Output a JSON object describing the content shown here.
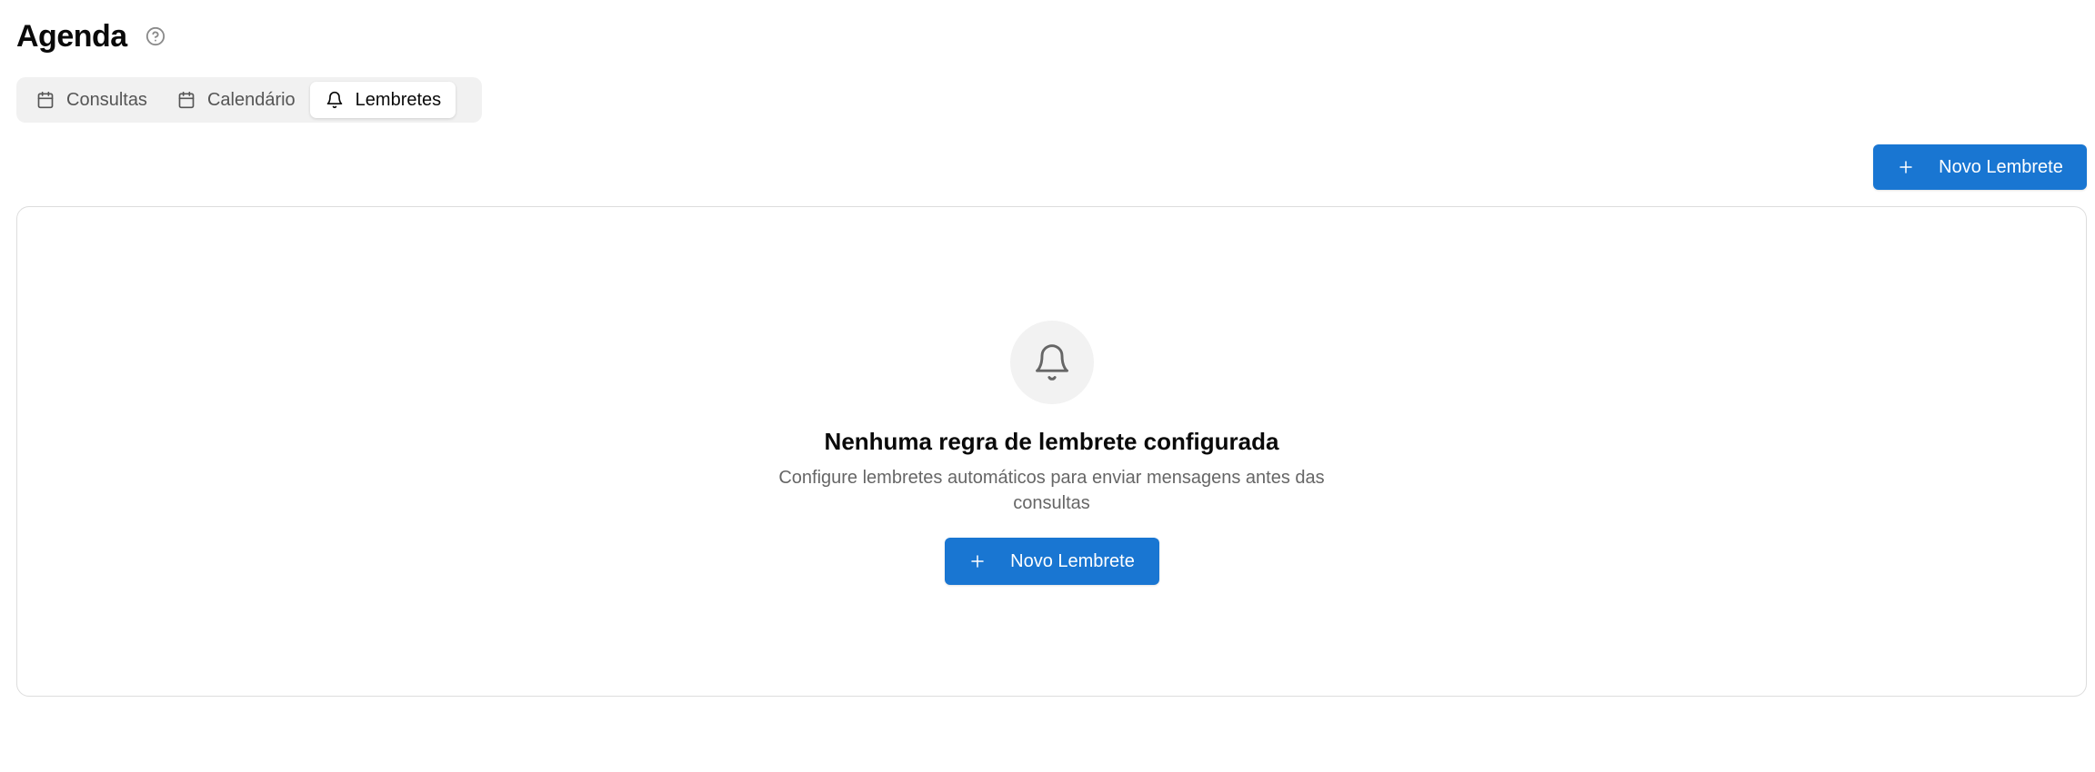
{
  "header": {
    "title": "Agenda",
    "help_icon": "help-circle-icon"
  },
  "tabs": [
    {
      "label": "Consultas",
      "icon": "calendar-icon",
      "active": false
    },
    {
      "label": "Calendário",
      "icon": "calendar-icon",
      "active": false
    },
    {
      "label": "Lembretes",
      "icon": "bell-icon",
      "active": true
    }
  ],
  "toolbar": {
    "new_reminder_label": "Novo Lembrete",
    "icon": "plus-icon"
  },
  "empty_state": {
    "icon": "bell-icon",
    "title": "Nenhuma regra de lembrete configurada",
    "description": "Configure lembretes automáticos para enviar mensagens antes das consultas",
    "action_label": "Novo Lembrete"
  },
  "colors": {
    "primary": "#1976d2",
    "tab_background": "#f1f1f1",
    "muted_text": "#666666",
    "border": "#dddddd"
  }
}
